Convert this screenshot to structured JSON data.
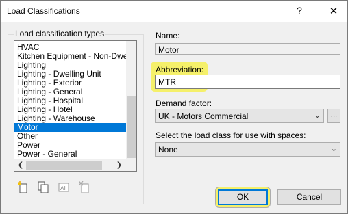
{
  "window": {
    "title": "Load Classifications",
    "help_glyph": "?",
    "close_glyph": "✕"
  },
  "group": {
    "label": "Load classification types",
    "items": [
      {
        "label": "HVAC"
      },
      {
        "label": "Kitchen Equipment - Non-Dwelling"
      },
      {
        "label": "Lighting"
      },
      {
        "label": "Lighting - Dwelling Unit"
      },
      {
        "label": "Lighting - Exterior"
      },
      {
        "label": "Lighting - General"
      },
      {
        "label": "Lighting - Hospital"
      },
      {
        "label": "Lighting - Hotel"
      },
      {
        "label": "Lighting - Warehouse"
      },
      {
        "label": "Motor"
      },
      {
        "label": "Other"
      },
      {
        "label": "Power"
      },
      {
        "label": "Power - General"
      }
    ],
    "selected_item": "Motor",
    "scroll_left_glyph": "❮",
    "scroll_right_glyph": "❯",
    "tools": [
      {
        "icon": "new-icon"
      },
      {
        "icon": "duplicate-icon"
      },
      {
        "icon": "rename-icon"
      },
      {
        "icon": "delete-icon"
      }
    ]
  },
  "form": {
    "name_label": "Name:",
    "name_value": "Motor",
    "abbreviation_label": "Abbreviation:",
    "abbreviation_value": "MTR",
    "demand_factor_label": "Demand factor:",
    "demand_factor_value": "UK - Motors Commercial",
    "demand_factor_button": "...",
    "space_load_class_label": "Select the load class for use with spaces:",
    "space_load_class_value": "None"
  },
  "buttons": {
    "ok": "OK",
    "cancel": "Cancel"
  },
  "colors": {
    "highlight": "#f5f06a",
    "selection": "#0078d7"
  }
}
